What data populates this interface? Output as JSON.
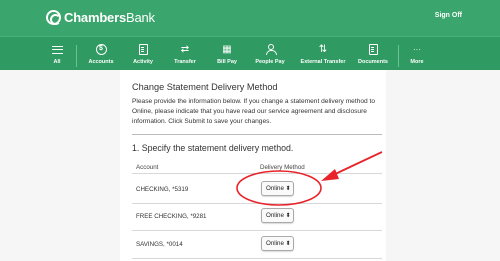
{
  "header": {
    "logo_bold": "Chambers",
    "logo_light": "Bank",
    "signoff": "Sign Off"
  },
  "nav": {
    "items": [
      {
        "label": "All",
        "icon": "menu-icon"
      },
      {
        "label": "Accounts",
        "icon": "dollar-icon",
        "glyph": "$"
      },
      {
        "label": "Activity",
        "icon": "document-icon"
      },
      {
        "label": "Transfer",
        "icon": "transfer-arrows-icon",
        "glyph": "⇄"
      },
      {
        "label": "Bill Pay",
        "icon": "calendar-icon",
        "glyph": "▦"
      },
      {
        "label": "People Pay",
        "icon": "people-icon"
      },
      {
        "label": "External Transfer",
        "icon": "up-down-arrows-icon",
        "glyph": "⇅"
      },
      {
        "label": "Documents",
        "icon": "documents-icon"
      },
      {
        "label": "More",
        "icon": "more-icon",
        "glyph": "···"
      }
    ]
  },
  "page": {
    "title": "Change Statement Delivery Method",
    "intro": "Please provide the information below. If you change a statement delivery method to Online, please indicate that you have read our service agreement and disclosure information. Click Submit to save your changes.",
    "step": "1. Specify the statement delivery method.",
    "col_account": "Account",
    "col_delivery": "Delivery Method",
    "rows": [
      {
        "account": "CHECKING, *5319",
        "method": "Online"
      },
      {
        "account": "FREE CHECKING, *9281",
        "method": "Online"
      },
      {
        "account": "SAVINGS, *0014",
        "method": "Online"
      }
    ]
  },
  "annotation": {
    "color": "#e8232a"
  }
}
